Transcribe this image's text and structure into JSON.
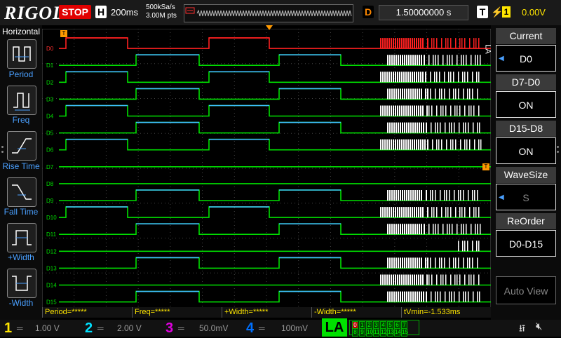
{
  "header": {
    "logo": "RIGOL",
    "run_state": "STOP",
    "timebase_label": "H",
    "timebase_value": "200ms",
    "sample_rate": "500kSa/s",
    "memory_depth": "3.00M pts",
    "delay_label": "D",
    "delay_value": "1.50000000 s",
    "trigger_label": "T",
    "trigger_source": "1",
    "trigger_level": "0.00V"
  },
  "left_menu": {
    "title": "Horizontal",
    "items": [
      {
        "label": "Period",
        "icon": "period-icon"
      },
      {
        "label": "Freq",
        "icon": "freq-icon"
      },
      {
        "label": "Rise Time",
        "icon": "rise-time-icon"
      },
      {
        "label": "Fall Time",
        "icon": "fall-time-icon"
      },
      {
        "label": "+Width",
        "icon": "positive-width-icon"
      },
      {
        "label": "-Width",
        "icon": "negative-width-icon"
      }
    ]
  },
  "right_menu": {
    "side_label": "LA",
    "items": [
      {
        "title": "Current",
        "value": "D0"
      },
      {
        "title": "D7-D0",
        "value": "ON"
      },
      {
        "title": "D15-D8",
        "value": "ON"
      },
      {
        "title": "WaveSize",
        "value": "S"
      },
      {
        "title": "ReOrder",
        "value": "D0-D15"
      },
      {
        "title": "",
        "value": "Auto View"
      }
    ]
  },
  "channels": [
    "D0",
    "D1",
    "D2",
    "D3",
    "D4",
    "D5",
    "D6",
    "D7",
    "D8",
    "D9",
    "D10",
    "D11",
    "D12",
    "D13",
    "D14",
    "D15"
  ],
  "measurements": [
    "Period=*****",
    "Freq=*****",
    "+Width=*****",
    "-Width=*****",
    "tVmin=-1.533ms"
  ],
  "bottom": {
    "ch1": {
      "num": "1",
      "value": "1.00 V",
      "color": "#ffe600"
    },
    "ch2": {
      "num": "2",
      "value": "2.00 V",
      "color": "#00e0ff"
    },
    "ch3": {
      "num": "3",
      "value": "50.0mV",
      "color": "#e000e0"
    },
    "ch4": {
      "num": "4",
      "value": "100mV",
      "color": "#0070ff"
    },
    "la_label": "LA",
    "la_row1": [
      "0",
      "1",
      "2",
      "3",
      "4",
      "5",
      "6",
      "7"
    ],
    "la_row2": [
      "8",
      "9",
      "10",
      "11",
      "12",
      "13",
      "14",
      "15"
    ]
  },
  "colors": {
    "trace": "#00e000",
    "trace_high": "#40c0ff",
    "active_trace": "#ff2020",
    "accent": "#ff9900"
  }
}
